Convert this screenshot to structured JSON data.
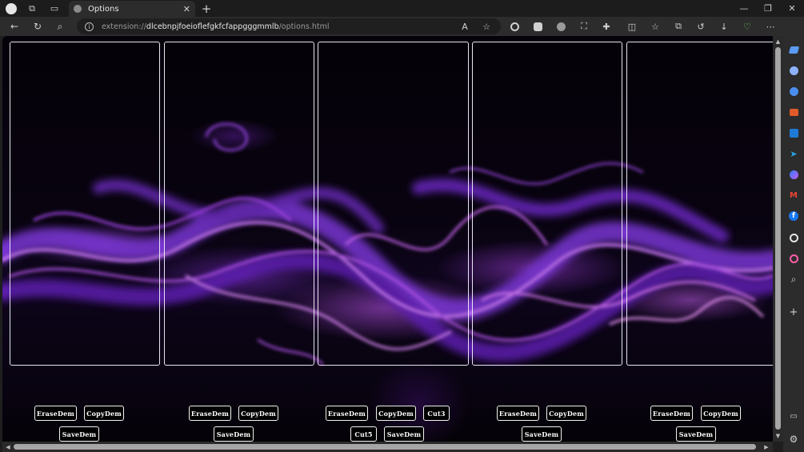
{
  "tab": {
    "title": "Options",
    "close_glyph": "✕"
  },
  "new_tab_glyph": "+",
  "window_controls": {
    "minimize": "—",
    "restore": "❐",
    "close": "✕"
  },
  "address_bar": {
    "scheme": "extension://",
    "host": "dlcebnpjfoeioflefgkfcfappgggmmlb",
    "path": "/options.html"
  },
  "toolbar_icons": [
    "read-aloud-icon",
    "favorite-star-icon",
    "extension-icon-1",
    "extension-icon-2",
    "extension-icon-3",
    "screenshot-icon",
    "extensions-puzzle-icon",
    "split-screen-icon",
    "favorites-icon",
    "collections-icon",
    "history-icon",
    "downloads-icon",
    "browser-essentials-icon",
    "more-menu-icon",
    "copilot-icon"
  ],
  "toolbar_glyphs": {
    "read_aloud": "A",
    "favorite": "☆",
    "split": "◫",
    "favorites": "☆",
    "collections": "⧉",
    "history": "↺",
    "downloads": "↓",
    "more": "⋯"
  },
  "sidebar_icons": [
    {
      "name": "sidebar-tag-icon",
      "color": "#5b9bf2"
    },
    {
      "name": "sidebar-people-icon",
      "color": "#8fb2ff"
    },
    {
      "name": "sidebar-copilot-icon",
      "color": "#4a8ff0"
    },
    {
      "name": "sidebar-tools-icon",
      "color": "#e05a2a"
    },
    {
      "name": "sidebar-outlook-icon",
      "color": "#1f7ad6"
    },
    {
      "name": "sidebar-telegram-icon",
      "color": "#2aa3e3"
    },
    {
      "name": "sidebar-messenger-icon",
      "color": "#a36cf5"
    },
    {
      "name": "sidebar-gmail-icon",
      "color": "#ea4335"
    },
    {
      "name": "sidebar-facebook-icon",
      "color": "#1877f2"
    },
    {
      "name": "sidebar-openai-icon",
      "color": "#e6e6e6"
    },
    {
      "name": "sidebar-circle-icon",
      "color": "#ff5ea8"
    },
    {
      "name": "sidebar-search-icon",
      "color": "#cfcfcf"
    }
  ],
  "sidebar_add_glyph": "+",
  "panels": [
    {
      "name": "panel-1"
    },
    {
      "name": "panel-2"
    },
    {
      "name": "panel-3"
    },
    {
      "name": "panel-4"
    },
    {
      "name": "panel-5"
    }
  ],
  "buttons": {
    "erase": "EraseDem",
    "copy": "CopyDem",
    "save": "SaveDem",
    "cut3": "Cut3",
    "cut5": "Cut5"
  },
  "colors": {
    "smoke_purple": "#b44cff",
    "smoke_magenta": "#e070ff",
    "panel_border": "#e9e4f5"
  }
}
